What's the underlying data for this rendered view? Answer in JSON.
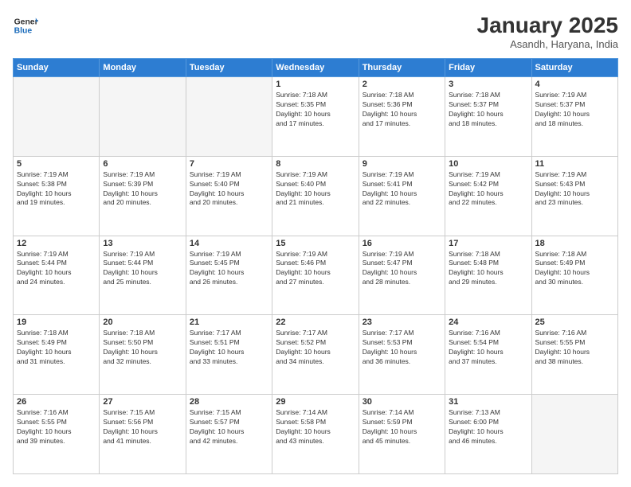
{
  "header": {
    "logo_line1": "General",
    "logo_line2": "Blue",
    "month": "January 2025",
    "location": "Asandh, Haryana, India"
  },
  "days_of_week": [
    "Sunday",
    "Monday",
    "Tuesday",
    "Wednesday",
    "Thursday",
    "Friday",
    "Saturday"
  ],
  "weeks": [
    [
      {
        "day": "",
        "info": ""
      },
      {
        "day": "",
        "info": ""
      },
      {
        "day": "",
        "info": ""
      },
      {
        "day": "1",
        "info": "Sunrise: 7:18 AM\nSunset: 5:35 PM\nDaylight: 10 hours\nand 17 minutes."
      },
      {
        "day": "2",
        "info": "Sunrise: 7:18 AM\nSunset: 5:36 PM\nDaylight: 10 hours\nand 17 minutes."
      },
      {
        "day": "3",
        "info": "Sunrise: 7:18 AM\nSunset: 5:37 PM\nDaylight: 10 hours\nand 18 minutes."
      },
      {
        "day": "4",
        "info": "Sunrise: 7:19 AM\nSunset: 5:37 PM\nDaylight: 10 hours\nand 18 minutes."
      }
    ],
    [
      {
        "day": "5",
        "info": "Sunrise: 7:19 AM\nSunset: 5:38 PM\nDaylight: 10 hours\nand 19 minutes."
      },
      {
        "day": "6",
        "info": "Sunrise: 7:19 AM\nSunset: 5:39 PM\nDaylight: 10 hours\nand 20 minutes."
      },
      {
        "day": "7",
        "info": "Sunrise: 7:19 AM\nSunset: 5:40 PM\nDaylight: 10 hours\nand 20 minutes."
      },
      {
        "day": "8",
        "info": "Sunrise: 7:19 AM\nSunset: 5:40 PM\nDaylight: 10 hours\nand 21 minutes."
      },
      {
        "day": "9",
        "info": "Sunrise: 7:19 AM\nSunset: 5:41 PM\nDaylight: 10 hours\nand 22 minutes."
      },
      {
        "day": "10",
        "info": "Sunrise: 7:19 AM\nSunset: 5:42 PM\nDaylight: 10 hours\nand 22 minutes."
      },
      {
        "day": "11",
        "info": "Sunrise: 7:19 AM\nSunset: 5:43 PM\nDaylight: 10 hours\nand 23 minutes."
      }
    ],
    [
      {
        "day": "12",
        "info": "Sunrise: 7:19 AM\nSunset: 5:44 PM\nDaylight: 10 hours\nand 24 minutes."
      },
      {
        "day": "13",
        "info": "Sunrise: 7:19 AM\nSunset: 5:44 PM\nDaylight: 10 hours\nand 25 minutes."
      },
      {
        "day": "14",
        "info": "Sunrise: 7:19 AM\nSunset: 5:45 PM\nDaylight: 10 hours\nand 26 minutes."
      },
      {
        "day": "15",
        "info": "Sunrise: 7:19 AM\nSunset: 5:46 PM\nDaylight: 10 hours\nand 27 minutes."
      },
      {
        "day": "16",
        "info": "Sunrise: 7:19 AM\nSunset: 5:47 PM\nDaylight: 10 hours\nand 28 minutes."
      },
      {
        "day": "17",
        "info": "Sunrise: 7:18 AM\nSunset: 5:48 PM\nDaylight: 10 hours\nand 29 minutes."
      },
      {
        "day": "18",
        "info": "Sunrise: 7:18 AM\nSunset: 5:49 PM\nDaylight: 10 hours\nand 30 minutes."
      }
    ],
    [
      {
        "day": "19",
        "info": "Sunrise: 7:18 AM\nSunset: 5:49 PM\nDaylight: 10 hours\nand 31 minutes."
      },
      {
        "day": "20",
        "info": "Sunrise: 7:18 AM\nSunset: 5:50 PM\nDaylight: 10 hours\nand 32 minutes."
      },
      {
        "day": "21",
        "info": "Sunrise: 7:17 AM\nSunset: 5:51 PM\nDaylight: 10 hours\nand 33 minutes."
      },
      {
        "day": "22",
        "info": "Sunrise: 7:17 AM\nSunset: 5:52 PM\nDaylight: 10 hours\nand 34 minutes."
      },
      {
        "day": "23",
        "info": "Sunrise: 7:17 AM\nSunset: 5:53 PM\nDaylight: 10 hours\nand 36 minutes."
      },
      {
        "day": "24",
        "info": "Sunrise: 7:16 AM\nSunset: 5:54 PM\nDaylight: 10 hours\nand 37 minutes."
      },
      {
        "day": "25",
        "info": "Sunrise: 7:16 AM\nSunset: 5:55 PM\nDaylight: 10 hours\nand 38 minutes."
      }
    ],
    [
      {
        "day": "26",
        "info": "Sunrise: 7:16 AM\nSunset: 5:55 PM\nDaylight: 10 hours\nand 39 minutes."
      },
      {
        "day": "27",
        "info": "Sunrise: 7:15 AM\nSunset: 5:56 PM\nDaylight: 10 hours\nand 41 minutes."
      },
      {
        "day": "28",
        "info": "Sunrise: 7:15 AM\nSunset: 5:57 PM\nDaylight: 10 hours\nand 42 minutes."
      },
      {
        "day": "29",
        "info": "Sunrise: 7:14 AM\nSunset: 5:58 PM\nDaylight: 10 hours\nand 43 minutes."
      },
      {
        "day": "30",
        "info": "Sunrise: 7:14 AM\nSunset: 5:59 PM\nDaylight: 10 hours\nand 45 minutes."
      },
      {
        "day": "31",
        "info": "Sunrise: 7:13 AM\nSunset: 6:00 PM\nDaylight: 10 hours\nand 46 minutes."
      },
      {
        "day": "",
        "info": ""
      }
    ]
  ]
}
